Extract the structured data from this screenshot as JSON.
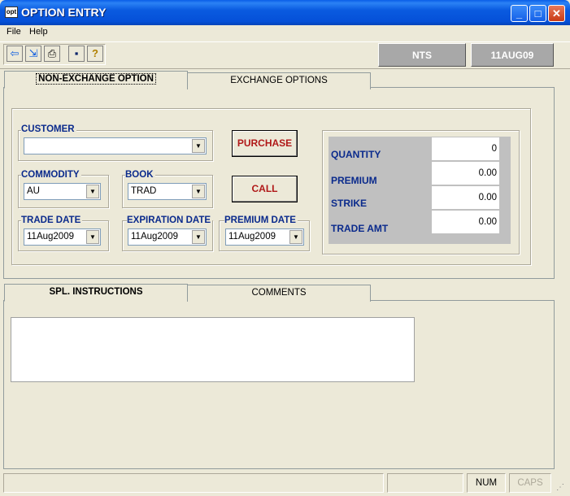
{
  "window": {
    "title": "OPTION ENTRY",
    "app_icon_text": "opt",
    "minimize": "_",
    "maximize": "□",
    "close": "✕"
  },
  "menu": [
    "File",
    "Help"
  ],
  "toolbar": {
    "buttons": [
      {
        "icon": "exit-icon",
        "glyph": "⇦"
      },
      {
        "icon": "import-icon",
        "glyph": "⇲"
      },
      {
        "icon": "print-icon",
        "glyph": "⎙"
      },
      {
        "icon": "save-icon",
        "glyph": "▪"
      },
      {
        "icon": "help-icon",
        "glyph": "?"
      }
    ],
    "status": [
      "NTS",
      "11AUG09"
    ]
  },
  "tabs_top": [
    "NON-EXCHANGE OPTION",
    "EXCHANGE OPTIONS"
  ],
  "form": {
    "customer": {
      "label": "CUSTOMER",
      "value": ""
    },
    "commodity": {
      "label": "COMMODITY",
      "value": "AU"
    },
    "book": {
      "label": "BOOK",
      "value": "TRAD"
    },
    "trade_date": {
      "label": "TRADE DATE",
      "value": "11Aug2009"
    },
    "expiration_date": {
      "label": "EXPIRATION DATE",
      "value": "11Aug2009"
    },
    "premium_date": {
      "label": "PREMIUM DATE",
      "value": "11Aug2009"
    },
    "purchase_button": "PURCHASE",
    "call_button": "CALL"
  },
  "values_panel": {
    "quantity": {
      "label": "QUANTITY",
      "value": "0"
    },
    "premium": {
      "label": "PREMIUM",
      "value": "0.00"
    },
    "strike": {
      "label": "STRIKE",
      "value": "0.00"
    },
    "trade_amt": {
      "label": "TRADE AMT",
      "value": "0.00"
    }
  },
  "tabs_bottom": [
    "SPL. INSTRUCTIONS",
    "COMMENTS"
  ],
  "statusbar": {
    "num": "NUM",
    "caps": "CAPS"
  },
  "colors": {
    "label_blue": "#0a2a8c",
    "button_red": "#b01818",
    "title_blue": "#0a5ee8"
  }
}
